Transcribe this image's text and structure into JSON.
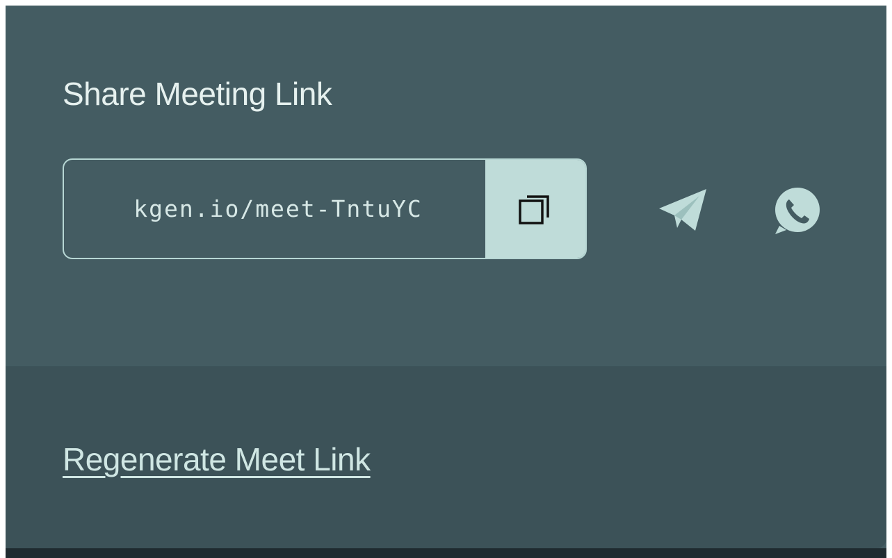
{
  "share": {
    "title": "Share Meeting Link",
    "link_text": "kgen.io/meet-TntuYC"
  },
  "icons": {
    "copy": "copy-icon",
    "telegram": "telegram-icon",
    "whatsapp": "whatsapp-icon"
  },
  "footer": {
    "regenerate_label": "Regenerate Meet Link"
  },
  "colors": {
    "panel": "#445c62",
    "footer": "#3c5258",
    "accent": "#bfdcd9",
    "text": "#e6f1ef"
  }
}
